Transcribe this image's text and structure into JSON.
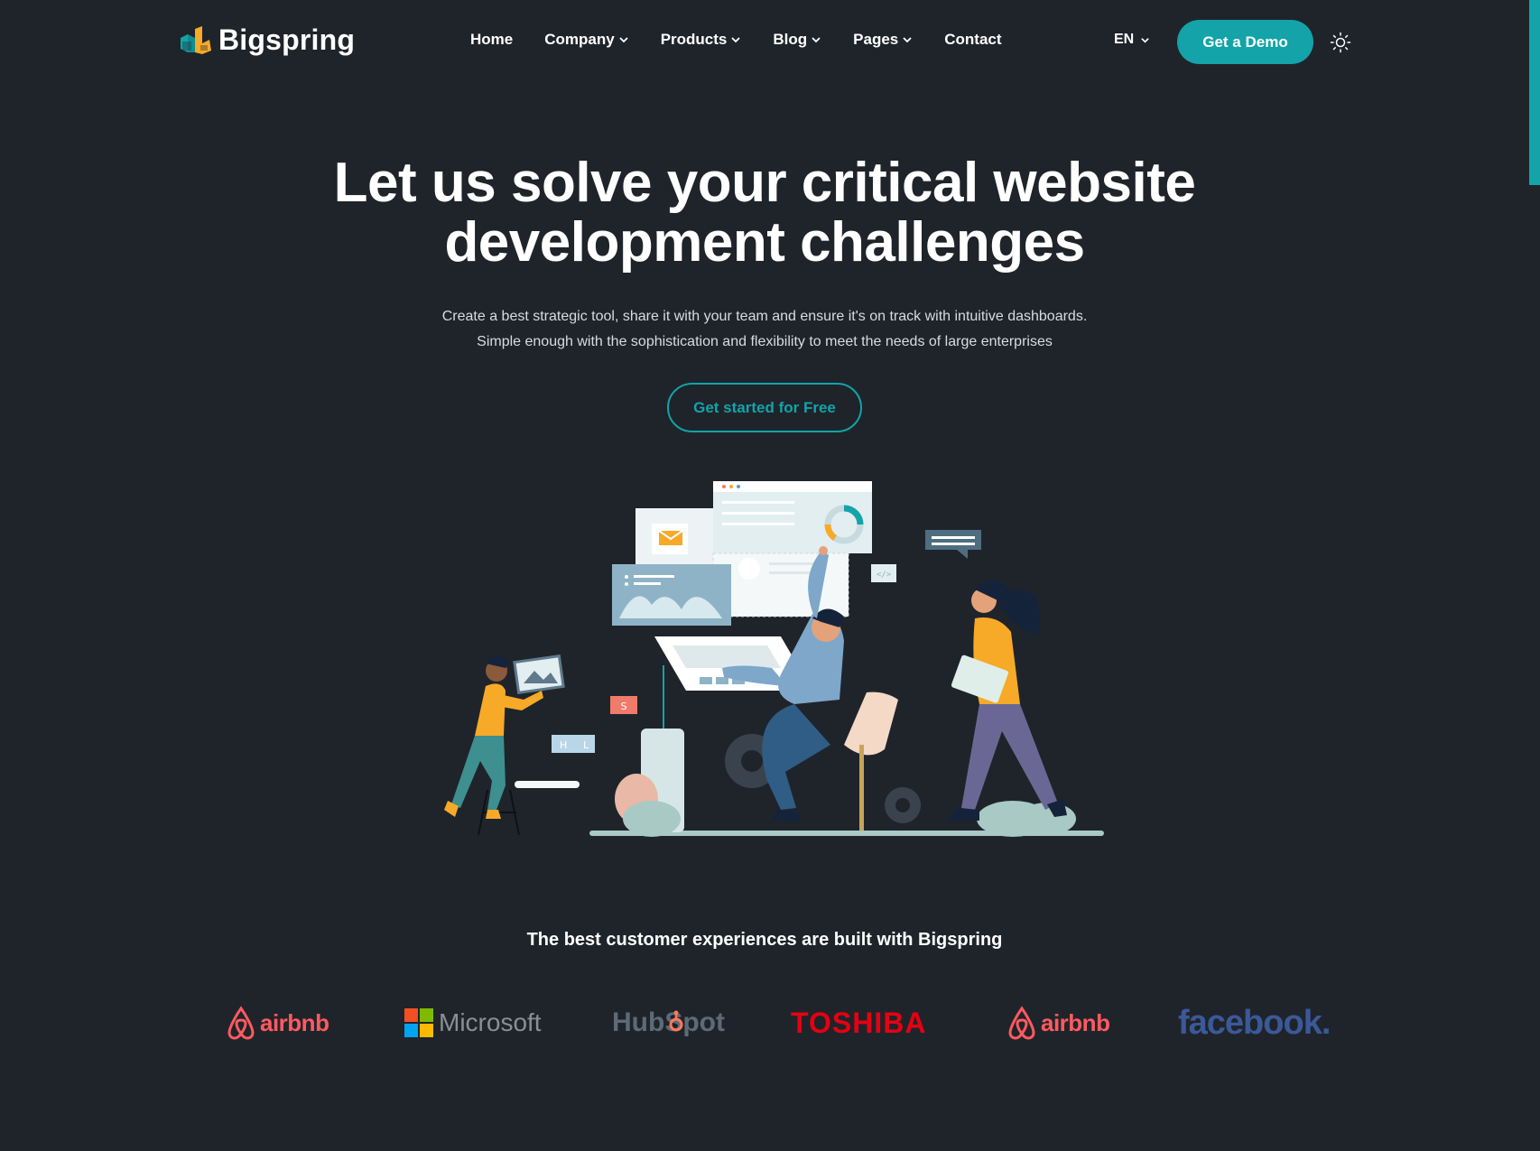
{
  "header": {
    "logo_text": "Bigspring",
    "nav": [
      {
        "label": "Home",
        "has_dropdown": false
      },
      {
        "label": "Company",
        "has_dropdown": true
      },
      {
        "label": "Products",
        "has_dropdown": true
      },
      {
        "label": "Blog",
        "has_dropdown": true
      },
      {
        "label": "Pages",
        "has_dropdown": true
      },
      {
        "label": "Contact",
        "has_dropdown": false
      }
    ],
    "language": "EN",
    "demo_button": "Get a Demo",
    "theme_icon": "sun-icon"
  },
  "hero": {
    "title_line1": "Let us solve your critical website",
    "title_line2": "development challenges",
    "subtitle_line1": "Create a best strategic tool, share it with your team and ensure it's on track with intuitive dashboards.",
    "subtitle_line2": "Simple enough with the sophistication and flexibility to meet the needs of large enterprises",
    "cta": "Get started for Free",
    "illustration_tags": {
      "s": "S",
      "h": "H",
      "l": "L"
    }
  },
  "clients": {
    "heading": "The best customer experiences are built with Bigspring",
    "logos": [
      {
        "name": "airbnb",
        "color": "#ff5a5f"
      },
      {
        "name": "Microsoft",
        "color": "#8a8f95"
      },
      {
        "name": "HubSpot",
        "color": "#5e6a78"
      },
      {
        "name": "TOSHIBA",
        "color": "#e60012"
      },
      {
        "name": "airbnb",
        "color": "#ff5a5f"
      },
      {
        "name": "facebook.",
        "color": "#3b5998"
      }
    ]
  },
  "colors": {
    "background": "#1f242b",
    "accent": "#13a3a8",
    "text": "#ffffff",
    "muted_text": "#d7dce1"
  }
}
